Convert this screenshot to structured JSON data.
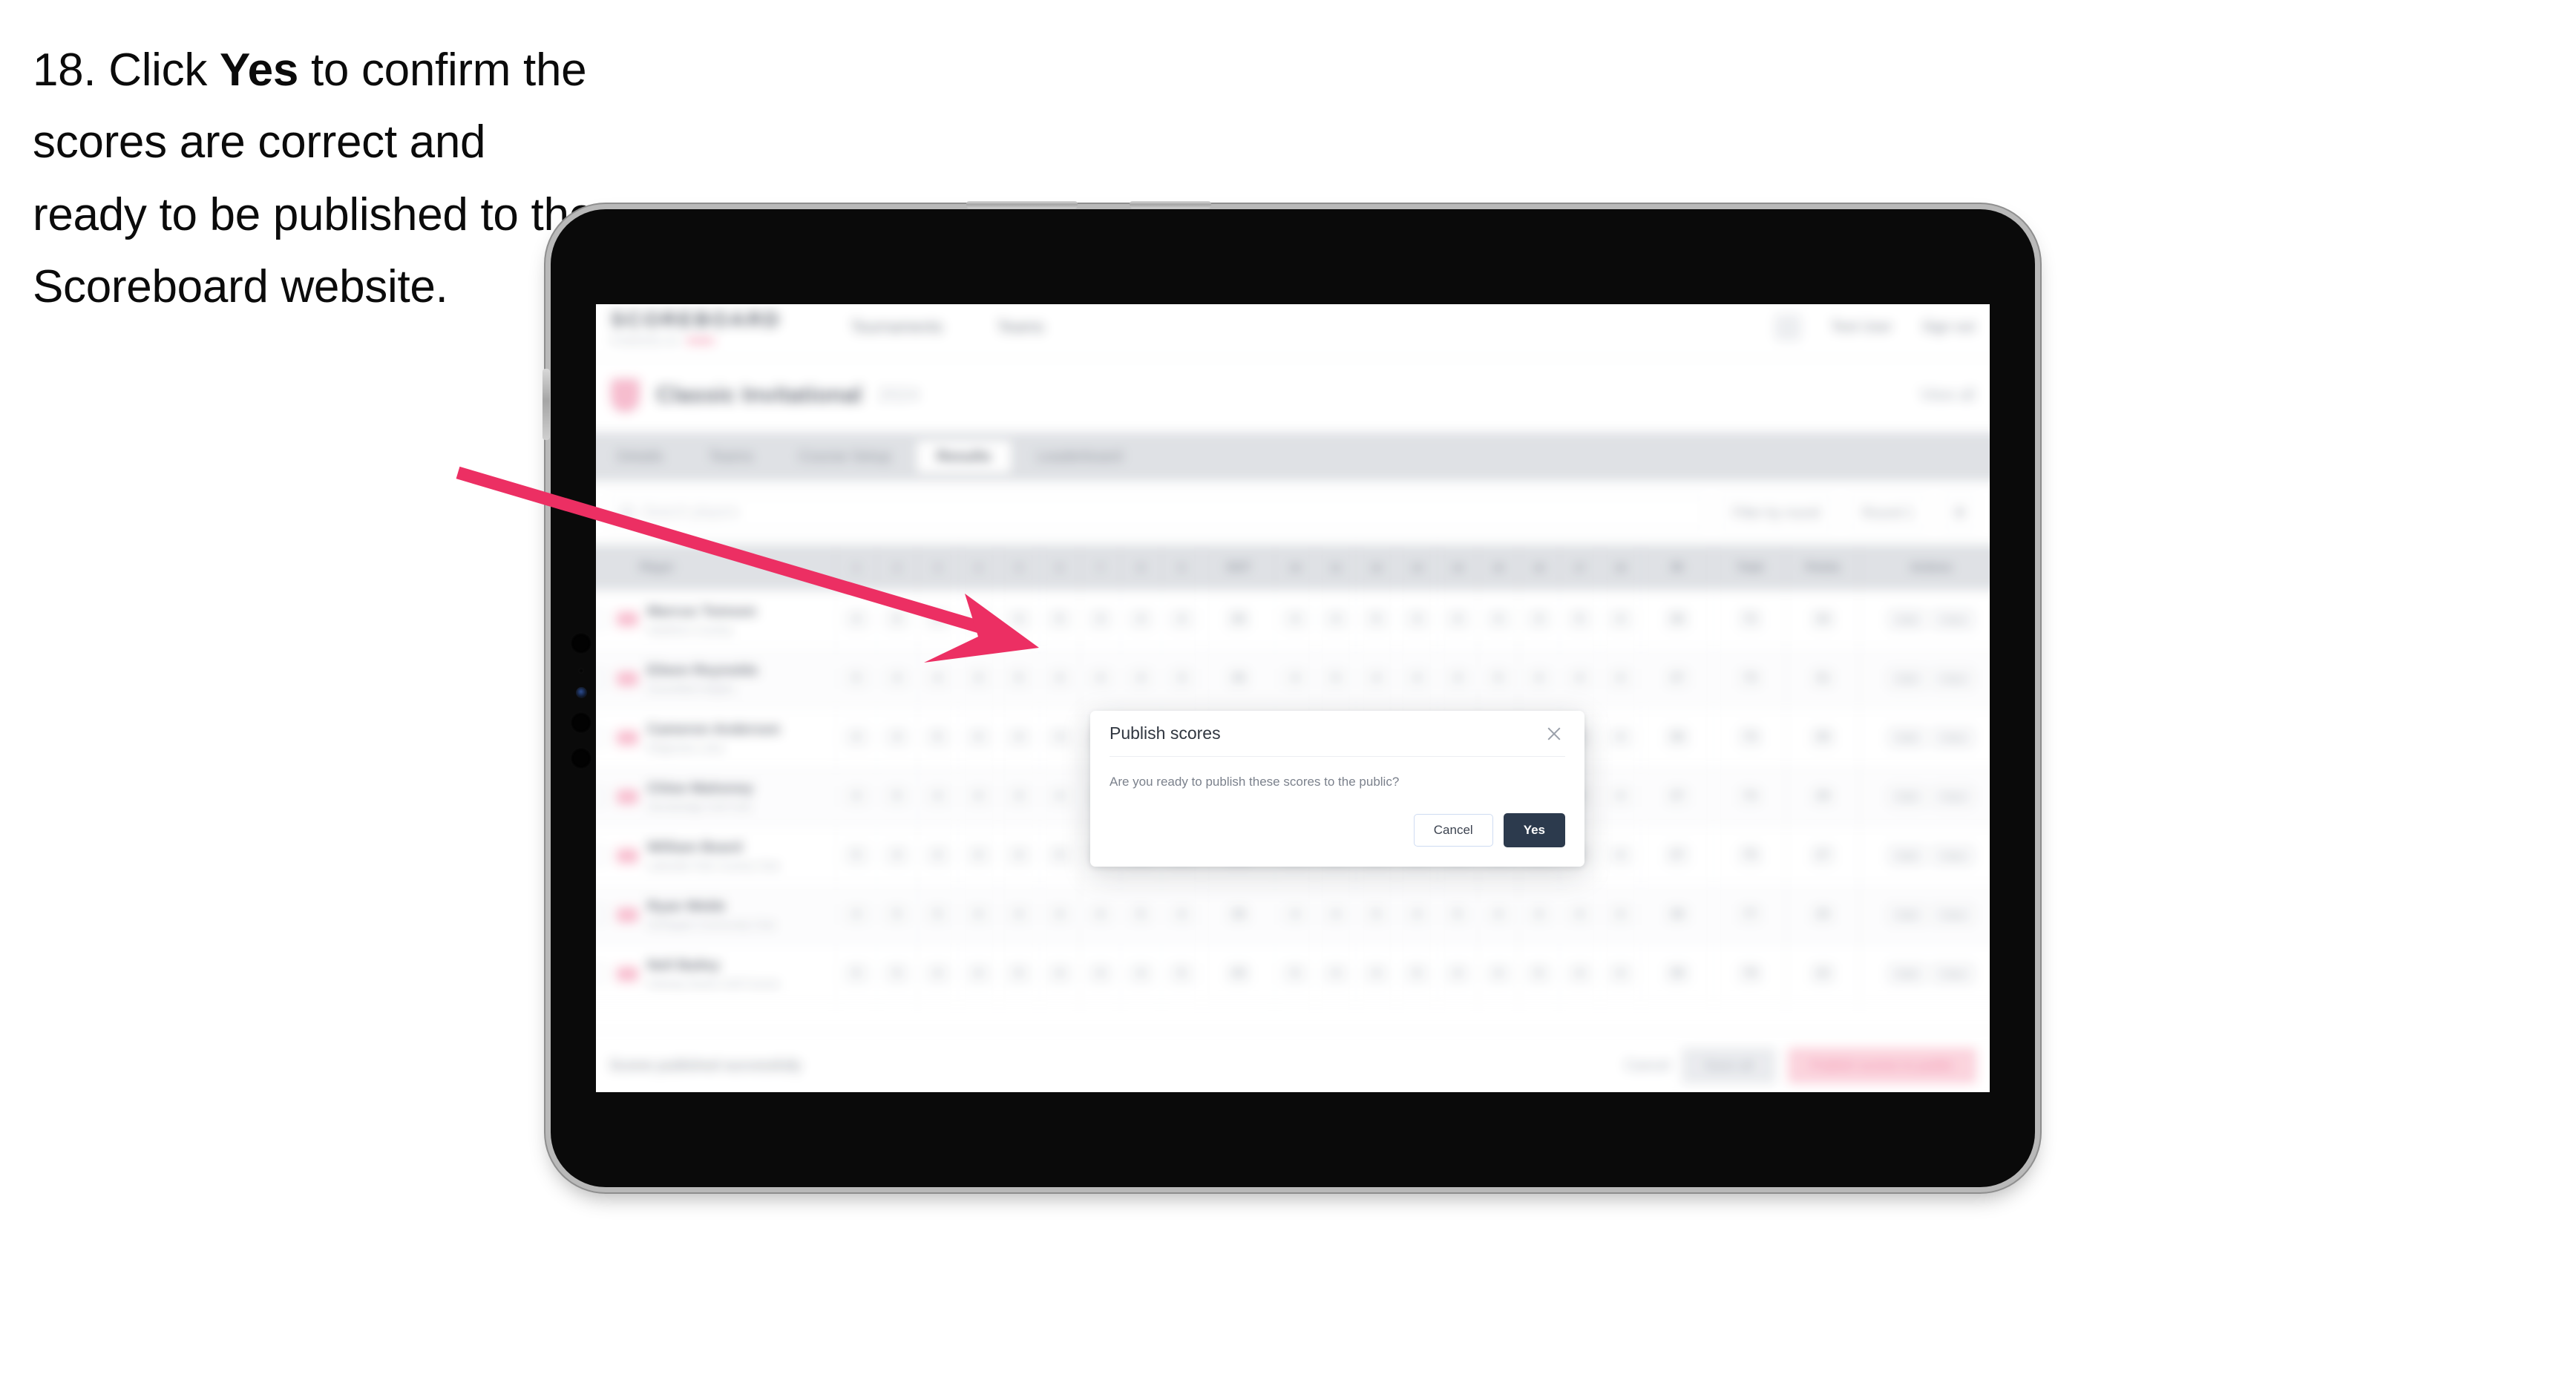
{
  "instruction": {
    "number": "18.",
    "text_before": "Click",
    "emphasis": "Yes",
    "text_after": "to confirm the scores are correct and ready to be published to the Scoreboard website."
  },
  "colors": {
    "arrow": "#ec2f63",
    "accent_pink": "#ed3b6b",
    "primary_dark": "#2c3a4d",
    "tabstrip_bg": "#d5d8dd"
  },
  "app": {
    "brand": {
      "title": "SCOREBOARD",
      "sub_left": "POWERED BY",
      "sub_accent": "HSBC"
    },
    "top_nav": [
      "Tournaments",
      "Teams"
    ],
    "top_right": {
      "icon": "bell-icon",
      "user_menu": "Test User",
      "sign_out": "Sign out"
    },
    "subhead": {
      "logo_icon": "tournament-shield-icon",
      "title": "Classic Invitational",
      "chip": "2024",
      "right_link": "View all"
    },
    "tabs": [
      {
        "label": "Details",
        "active": false
      },
      {
        "label": "Teams",
        "active": false
      },
      {
        "label": "Course Setup",
        "active": false
      },
      {
        "label": "Results",
        "active": true
      },
      {
        "label": "Leaderboard",
        "active": false
      }
    ],
    "filter_bar": {
      "search_icon": "search-icon",
      "search_placeholder": "Search players",
      "buttons": [
        "Filter by round",
        "Round 1"
      ],
      "icon_button": "table-settings-icon"
    },
    "table": {
      "columns": [
        "Player",
        "1",
        "2",
        "3",
        "4",
        "5",
        "6",
        "7",
        "8",
        "9",
        "OUT",
        "10",
        "11",
        "12",
        "13",
        "14",
        "15",
        "16",
        "17",
        "18",
        "IN",
        "Total",
        "Points",
        "Actions"
      ],
      "rows": [
        {
          "name": "Marcus Tomson",
          "sub": "Hawthorn Country",
          "holes": [
            "4",
            "5",
            "3",
            "4",
            "4",
            "5",
            "3",
            "4",
            "4"
          ],
          "out": "36",
          "holes_in": [
            "4",
            "4",
            "5",
            "3",
            "4",
            "4",
            "3",
            "5",
            "4"
          ],
          "in": "36",
          "total": "72",
          "points": "34",
          "actions": [
            "Edit",
            "View"
          ]
        },
        {
          "name": "Eileen Reynolds",
          "sub": "Greenfield Heights",
          "holes": [
            "5",
            "4",
            "4",
            "3",
            "5",
            "4",
            "4",
            "4",
            "3"
          ],
          "out": "36",
          "holes_in": [
            "4",
            "5",
            "4",
            "4",
            "3",
            "5",
            "4",
            "4",
            "4"
          ],
          "in": "37",
          "total": "73",
          "points": "31",
          "actions": [
            "Edit",
            "View"
          ]
        },
        {
          "name": "Cameron Anderson",
          "sub": "Ridgeview Links",
          "holes": [
            "4",
            "4",
            "5",
            "4",
            "4",
            "3",
            "5",
            "4",
            "4"
          ],
          "out": "37",
          "holes_in": [
            "5",
            "4",
            "3",
            "4",
            "4",
            "5",
            "4",
            "3",
            "4"
          ],
          "in": "36",
          "total": "73",
          "points": "30",
          "actions": [
            "Edit",
            "View"
          ]
        },
        {
          "name": "Chloe Mahoney",
          "sub": "Stonebridge Golf Club",
          "holes": [
            "4",
            "5",
            "4",
            "4",
            "3",
            "4",
            "4",
            "5",
            "4"
          ],
          "out": "37",
          "holes_in": [
            "4",
            "4",
            "4",
            "5",
            "3",
            "4",
            "5",
            "4",
            "4"
          ],
          "in": "37",
          "total": "74",
          "points": "29",
          "actions": [
            "Edit",
            "View"
          ]
        },
        {
          "name": "William Beard",
          "sub": "Lakeside Park Country Club",
          "holes": [
            "5",
            "4",
            "4",
            "4",
            "4",
            "5",
            "3",
            "4",
            "5"
          ],
          "out": "38",
          "holes_in": [
            "4",
            "5",
            "4",
            "3",
            "4",
            "4",
            "5",
            "4",
            "4"
          ],
          "in": "37",
          "total": "75",
          "points": "27",
          "actions": [
            "Edit",
            "View"
          ]
        },
        {
          "name": "Ryan Webb",
          "sub": "Northgate Community Club",
          "holes": [
            "4",
            "5",
            "5",
            "4",
            "4",
            "4",
            "4",
            "5",
            "4"
          ],
          "out": "39",
          "holes_in": [
            "4",
            "4",
            "5",
            "4",
            "5",
            "4",
            "4",
            "4",
            "4"
          ],
          "in": "38",
          "total": "77",
          "points": "25",
          "actions": [
            "Edit",
            "View"
          ]
        },
        {
          "name": "Nell Bailey",
          "sub": "Fairway Downs Golf Course",
          "holes": [
            "5",
            "5",
            "4",
            "4",
            "5",
            "4",
            "4",
            "4",
            "5"
          ],
          "out": "40",
          "holes_in": [
            "5",
            "4",
            "4",
            "5",
            "4",
            "4",
            "5",
            "4",
            "4"
          ],
          "in": "39",
          "total": "79",
          "points": "22",
          "actions": [
            "Edit",
            "View"
          ]
        }
      ]
    },
    "bottom_bar": {
      "note": "Scores published successfully",
      "link": "Cancel",
      "secondary_button": "Save all",
      "primary_button": "Publish scores to public"
    }
  },
  "modal": {
    "title": "Publish scores",
    "close_icon": "close-icon",
    "message": "Are you ready to publish these scores to the public?",
    "cancel_label": "Cancel",
    "confirm_label": "Yes"
  }
}
